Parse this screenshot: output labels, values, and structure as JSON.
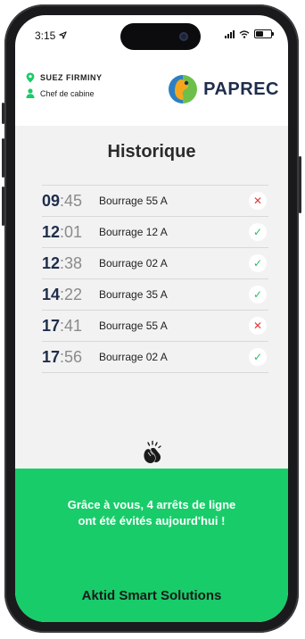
{
  "status_bar": {
    "time": "3:15"
  },
  "header": {
    "site": "SUEZ FIRMINY",
    "role": "Chef de cabine",
    "brand": "PAPREC"
  },
  "history": {
    "title": "Historique",
    "rows": [
      {
        "hour": "09",
        "minute": ":45",
        "label": "Bourrage 55 A",
        "status": "failed",
        "symbol": "✕"
      },
      {
        "hour": "12",
        "minute": ":01",
        "label": "Bourrage 12 A",
        "status": "resolved",
        "symbol": "✓"
      },
      {
        "hour": "12",
        "minute": ":38",
        "label": "Bourrage 02 A",
        "status": "resolved",
        "symbol": "✓"
      },
      {
        "hour": "14",
        "minute": ":22",
        "label": "Bourrage 35 A",
        "status": "resolved",
        "symbol": "✓"
      },
      {
        "hour": "17",
        "minute": ":41",
        "label": "Bourrage 55 A",
        "status": "failed",
        "symbol": "✕"
      },
      {
        "hour": "17",
        "minute": ":56",
        "label": "Bourrage 02 A",
        "status": "resolved",
        "symbol": "✓"
      }
    ]
  },
  "footer": {
    "message_line1": "Grâce à vous, 4 arrêts de ligne",
    "message_line2": "ont été évités aujourd'hui !",
    "brand": "Aktid Smart Solutions"
  },
  "colors": {
    "accent_green": "#18cc6a",
    "navy": "#1f2d4c",
    "error_red": "#e53a3a",
    "success_green": "#22c06a"
  },
  "icons": {
    "site": "location-pin-icon",
    "role": "user-icon",
    "celebration": "clapping-hands-icon"
  }
}
